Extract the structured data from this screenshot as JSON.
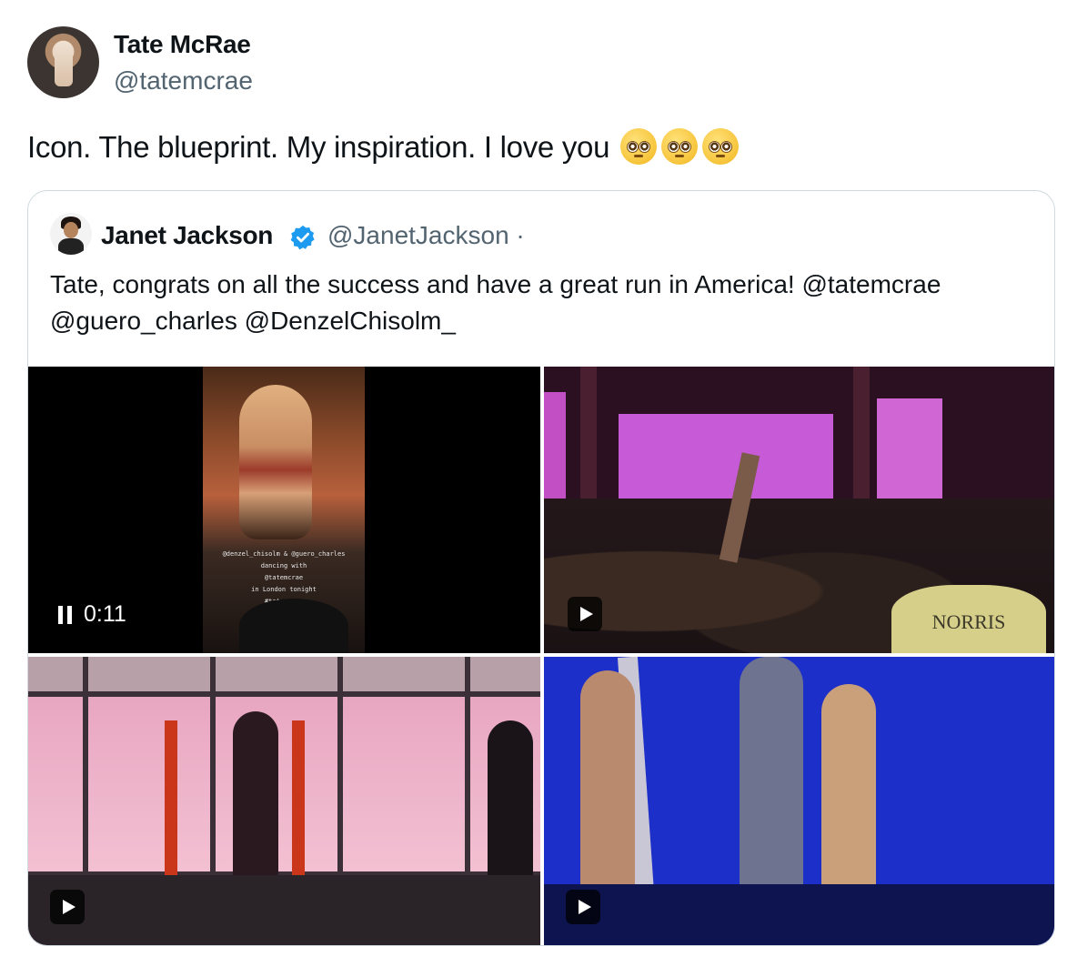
{
  "author": {
    "name": "Tate McRae",
    "handle": "@tatemcrae"
  },
  "tweet": {
    "text": "Icon. The blueprint. My inspiration. I love you",
    "emojis": [
      "pleading-face-icon",
      "pleading-face-icon",
      "pleading-face-icon"
    ]
  },
  "quoted": {
    "name": "Janet Jackson",
    "handle": "@JanetJackson ·",
    "verified": true,
    "text": "Tate, congrats on all the success and have a great run in America! @tatemcrae @guero_charles @DenzelChisolm_",
    "media": {
      "video1": {
        "timer": "0:11",
        "caption_lines": [
          "@denzel_chisolm & @guero_charles",
          "dancing with",
          "@tatemcrae",
          "in London tonight",
          "#tatemcrae"
        ]
      },
      "video2": {
        "shirt_text": "NORRIS"
      }
    }
  },
  "colors": {
    "text": "#0f1419",
    "secondary": "#536471",
    "verified": "#1d9bf0",
    "border": "#cfd9de"
  }
}
